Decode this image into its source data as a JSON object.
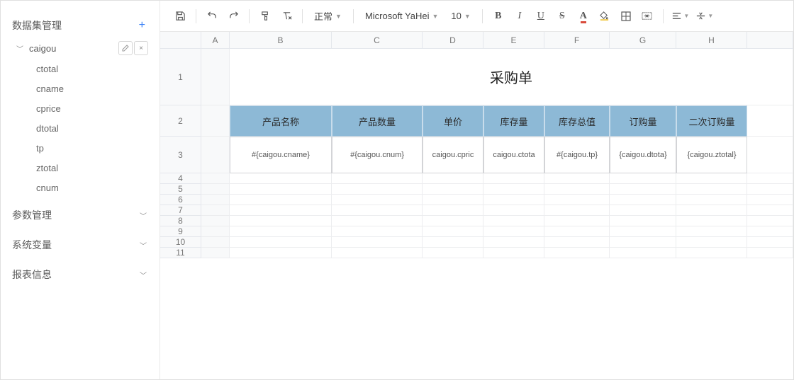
{
  "sidebar": {
    "sections": [
      {
        "label": "数据集管理",
        "hasPlus": true,
        "expanded": true
      },
      {
        "label": "参数管理",
        "hasPlus": false,
        "expanded": false
      },
      {
        "label": "系统变量",
        "hasPlus": false,
        "expanded": false
      },
      {
        "label": "报表信息",
        "hasPlus": false,
        "expanded": false
      }
    ],
    "dataset": {
      "name": "caigou",
      "fields": [
        "ctotal",
        "cname",
        "cprice",
        "dtotal",
        "tp",
        "ztotal",
        "cnum"
      ]
    }
  },
  "toolbar": {
    "styleLabel": "正常",
    "fontLabel": "Microsoft YaHei",
    "fontSize": "10"
  },
  "sheet": {
    "columns": [
      "A",
      "B",
      "C",
      "D",
      "E",
      "F",
      "G",
      "H"
    ],
    "titleCell": "采购单",
    "headerRow": [
      "产品名称",
      "产品数量",
      "单价",
      "库存量",
      "库存总值",
      "订购量",
      "二次订购量"
    ],
    "dataRow": [
      "#{caigou.cname}",
      "#{caigou.cnum}",
      "caigou.cpric",
      "caigou.ctota",
      "#{caigou.tp}",
      "{caigou.dtota}",
      "{caigou.ztotal}"
    ],
    "rowNumbers": [
      "1",
      "2",
      "3",
      "4",
      "5",
      "6",
      "7",
      "8",
      "9",
      "10",
      "11"
    ]
  }
}
